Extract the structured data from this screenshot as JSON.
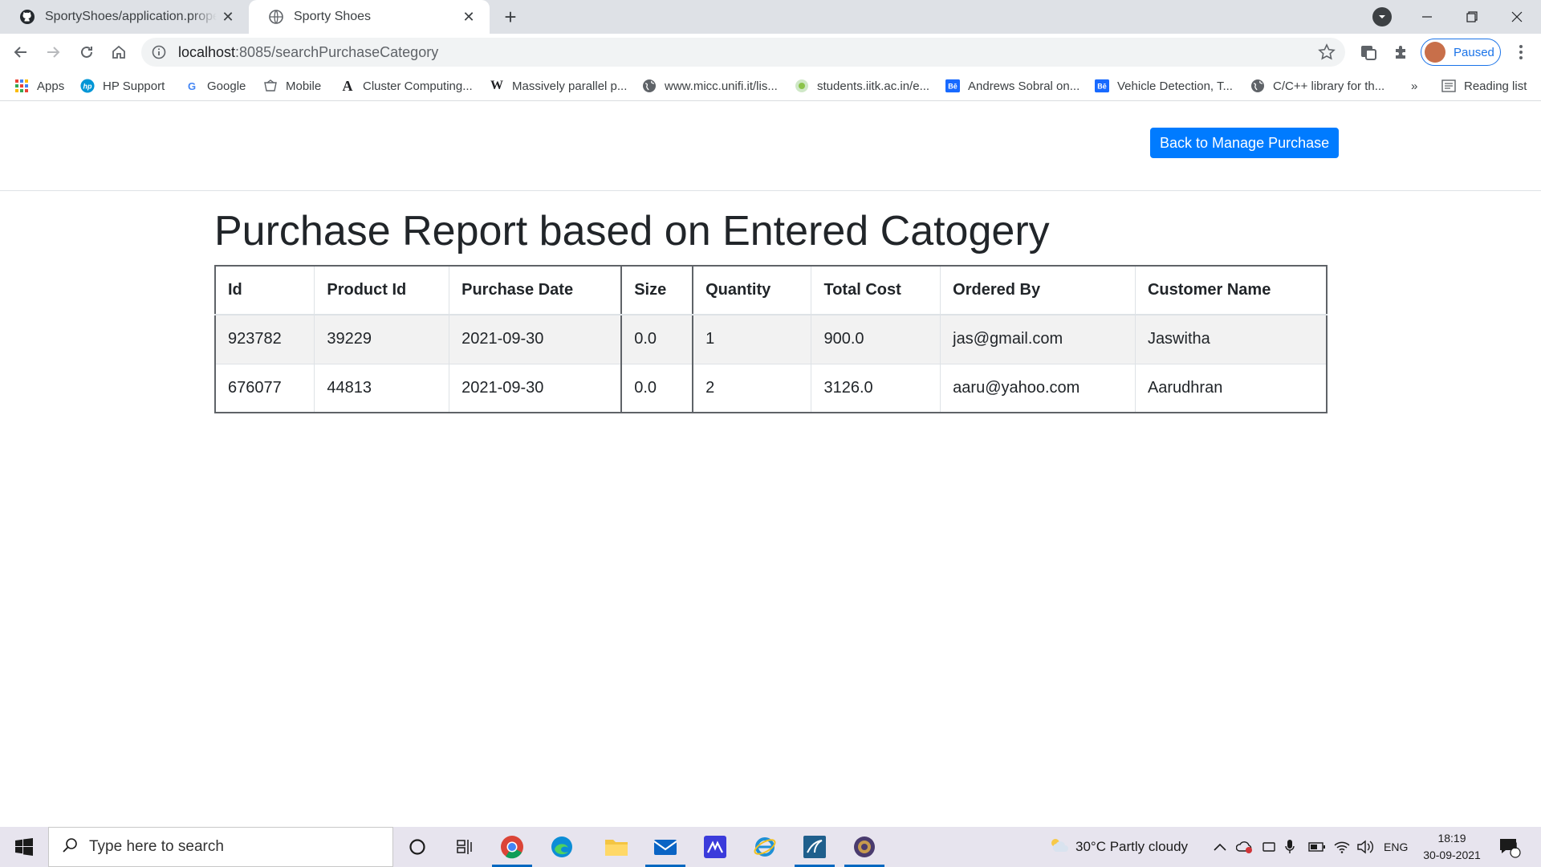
{
  "browser": {
    "tabs": [
      {
        "title": "SportyShoes/application.properti",
        "icon": "github-icon"
      },
      {
        "title": "Sporty Shoes",
        "icon": "globe-icon"
      }
    ],
    "url_host": "localhost",
    "url_rest": ":8085/searchPurchaseCategory",
    "profile_label": "Paused",
    "bookmarks": [
      {
        "label": "Apps",
        "icon": "apps-grid-icon"
      },
      {
        "label": "HP Support",
        "icon": "hp-icon"
      },
      {
        "label": "Google",
        "icon": "google-icon"
      },
      {
        "label": "Mobile",
        "icon": "mobile-icon"
      },
      {
        "label": "Cluster Computing...",
        "icon": "a-icon"
      },
      {
        "label": "Massively parallel p...",
        "icon": "wikipedia-icon"
      },
      {
        "label": "www.micc.unifi.it/lis...",
        "icon": "globe-icon"
      },
      {
        "label": "students.iitk.ac.in/e...",
        "icon": "site-icon"
      },
      {
        "label": "Andrews Sobral on...",
        "icon": "behance-icon"
      },
      {
        "label": "Vehicle Detection, T...",
        "icon": "behance-icon"
      },
      {
        "label": "C/C++ library for th...",
        "icon": "globe-icon"
      }
    ],
    "overflow_label": "»",
    "reading_list_label": "Reading list"
  },
  "page": {
    "back_button": "Back to Manage Purchase",
    "title": "Purchase Report based on Entered Catogery",
    "table": {
      "headers": [
        "Id",
        "Product Id",
        "Purchase Date",
        "Size",
        "Quantity",
        "Total Cost",
        "Ordered By",
        "Customer Name"
      ],
      "rows": [
        [
          "923782",
          "39229",
          "2021-09-30",
          "0.0",
          "1",
          "900.0",
          "jas@gmail.com",
          "Jaswitha"
        ],
        [
          "676077",
          "44813",
          "2021-09-30",
          "0.0",
          "2",
          "3126.0",
          "aaru@yahoo.com",
          "Aarudhran"
        ]
      ]
    }
  },
  "taskbar": {
    "search_placeholder": "Type here to search",
    "weather": "30°C  Partly cloudy",
    "language": "ENG",
    "time": "18:19",
    "date": "30-09-2021",
    "notification_count": "1"
  },
  "colors": {
    "primary": "#007bff",
    "chrome_tabstrip": "#dee1e6",
    "taskbar": "#e7e4ee"
  }
}
